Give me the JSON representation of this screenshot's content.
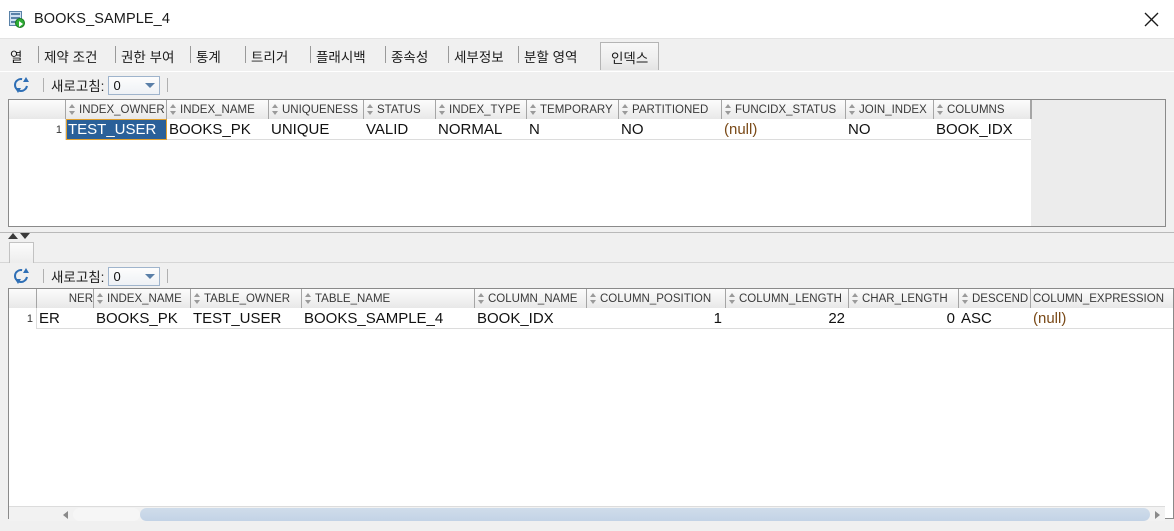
{
  "window": {
    "title": "BOOKS_SAMPLE_4",
    "icon": "table-run-icon",
    "close_label": "✕"
  },
  "tabs": [
    {
      "label": "열"
    },
    {
      "label": "제약 조건"
    },
    {
      "label": "권한 부여"
    },
    {
      "label": "통계"
    },
    {
      "label": "트리거"
    },
    {
      "label": "플래시백"
    },
    {
      "label": "종속성"
    },
    {
      "label": "세부정보"
    },
    {
      "label": "분할 영역"
    },
    {
      "label": "인덱스"
    }
  ],
  "active_tab_index": 9,
  "toolbar_top": {
    "refresh_icon": "refresh-icon",
    "refresh_label": "새로고침:",
    "refresh_value": "0"
  },
  "toolbar_bottom": {
    "refresh_icon": "refresh-icon",
    "refresh_label": "새로고침:",
    "refresh_value": "0"
  },
  "grid_top": {
    "row_number": "1",
    "columns": [
      "INDEX_OWNER",
      "INDEX_NAME",
      "UNIQUENESS",
      "STATUS",
      "INDEX_TYPE",
      "TEMPORARY",
      "PARTITIONED",
      "FUNCIDX_STATUS",
      "JOIN_INDEX",
      "COLUMNS"
    ],
    "rows": [
      {
        "INDEX_OWNER": "TEST_USER",
        "INDEX_NAME": "BOOKS_PK",
        "UNIQUENESS": "UNIQUE",
        "STATUS": "VALID",
        "INDEX_TYPE": "NORMAL",
        "TEMPORARY": "N",
        "PARTITIONED": "NO",
        "FUNCIDX_STATUS": "(null)",
        "JOIN_INDEX": "NO",
        "COLUMNS": "BOOK_IDX"
      }
    ],
    "selected_cell": "INDEX_OWNER"
  },
  "grid_bottom": {
    "row_number": "1",
    "columns": [
      "NER",
      "INDEX_NAME",
      "TABLE_OWNER",
      "TABLE_NAME",
      "COLUMN_NAME",
      "COLUMN_POSITION",
      "COLUMN_LENGTH",
      "CHAR_LENGTH",
      "DESCEND",
      "COLUMN_EXPRESSION"
    ],
    "rows": [
      {
        "NER": "ER",
        "INDEX_NAME": "BOOKS_PK",
        "TABLE_OWNER": "TEST_USER",
        "TABLE_NAME": "BOOKS_SAMPLE_4",
        "COLUMN_NAME": "BOOK_IDX",
        "COLUMN_POSITION": "1",
        "COLUMN_LENGTH": "22",
        "CHAR_LENGTH": "0",
        "DESCEND": "ASC",
        "COLUMN_EXPRESSION": "(null)"
      }
    ]
  },
  "colors": {
    "selection_bg": "#2a6099",
    "selection_border": "#e0a030",
    "null_text": "#7a4a18",
    "scroll_thumb": "#c3d3e6"
  }
}
